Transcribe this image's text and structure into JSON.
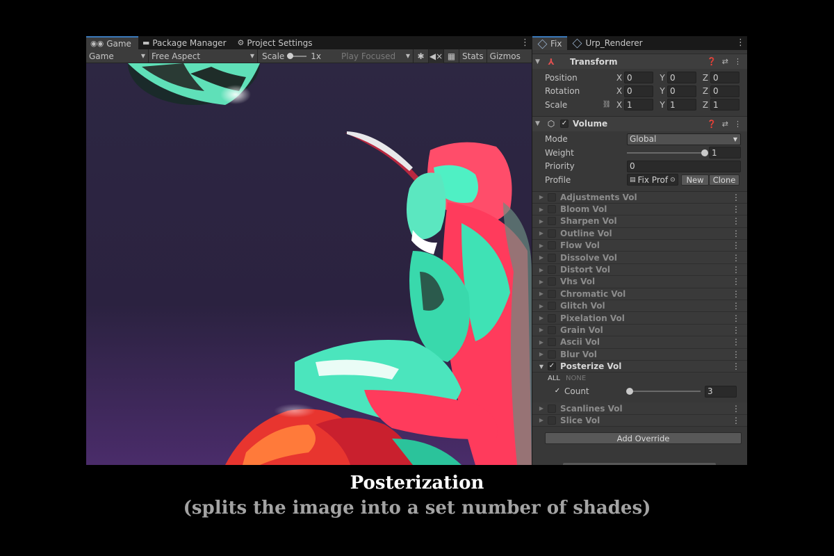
{
  "game_tabs": [
    {
      "label": "Game",
      "icon": "gamepad-icon"
    },
    {
      "label": "Package Manager",
      "icon": "package-icon"
    },
    {
      "label": "Project Settings",
      "icon": "gear-icon"
    }
  ],
  "game_toolbar": {
    "display": "Game",
    "aspect": "Free Aspect",
    "scale_label": "Scale",
    "scale_value": "1x",
    "play_mode": "Play Focused",
    "stats": "Stats",
    "gizmos": "Gizmos"
  },
  "inspector_tabs": [
    {
      "label": "Fix"
    },
    {
      "label": "Urp_Renderer"
    }
  ],
  "transform": {
    "title": "Transform",
    "rows": [
      {
        "label": "Position",
        "x": "0",
        "y": "0",
        "z": "0"
      },
      {
        "label": "Rotation",
        "x": "0",
        "y": "0",
        "z": "0"
      },
      {
        "label": "Scale",
        "x": "1",
        "y": "1",
        "z": "1"
      }
    ],
    "axis_x": "X",
    "axis_y": "Y",
    "axis_z": "Z"
  },
  "volume": {
    "title": "Volume",
    "mode_label": "Mode",
    "mode_value": "Global",
    "weight_label": "Weight",
    "weight_value": "1",
    "weight_fraction": 1.0,
    "priority_label": "Priority",
    "priority_value": "0",
    "profile_label": "Profile",
    "profile_value": "Fix Prof",
    "new_label": "New",
    "clone_label": "Clone"
  },
  "overrides_before": [
    "Adjustments Vol",
    "Bloom Vol",
    "Sharpen Vol",
    "Outline Vol",
    "Flow Vol",
    "Dissolve Vol",
    "Distort Vol",
    "Vhs Vol",
    "Chromatic Vol",
    "Glitch Vol",
    "Pixelation Vol",
    "Grain Vol",
    "Ascii Vol",
    "Blur Vol"
  ],
  "posterize": {
    "name": "Posterize Vol",
    "all_label": "ALL",
    "none_label": "NONE",
    "count_label": "Count",
    "count_value": "3",
    "count_fraction": 0.02
  },
  "overrides_after": [
    "Scanlines Vol",
    "Slice Vol"
  ],
  "add_override_label": "Add Override",
  "caption": {
    "title": "Posterization",
    "subtitle": "(splits the image into a set number of shades)"
  },
  "colors": {
    "accent_tab": "#3a79bb",
    "caption_title": "#ffffff",
    "caption_sub": "#a3a3a3"
  }
}
